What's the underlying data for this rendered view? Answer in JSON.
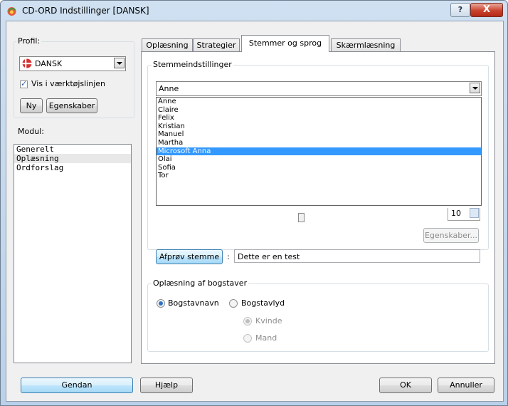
{
  "window": {
    "title": "CD-ORD Indstillinger [DANSK]",
    "help_label": "?",
    "close_label": "X"
  },
  "profile": {
    "group_label": "Profil:",
    "selected": "DANSK",
    "toolbar_checkbox_label": "Vis i værktøjslinjen",
    "toolbar_checked": true,
    "new_button": "Ny",
    "properties_button": "Egenskaber"
  },
  "module": {
    "group_label": "Modul:",
    "items": [
      "Generelt",
      "Oplæsning",
      "Ordforslag"
    ],
    "selected_index": 1
  },
  "tabs": [
    {
      "label": "Oplæsning"
    },
    {
      "label": "Strategier"
    },
    {
      "label": "Stemmer og sprog"
    },
    {
      "label": "Skærmlæsning"
    }
  ],
  "active_tab": 2,
  "voice_settings": {
    "group_label": "Stemmeindstillinger",
    "selected_voice": "Anne",
    "voice_options": [
      "Anne",
      "Claire",
      "Felix",
      "Kristian",
      "Manuel",
      "Martha",
      "Microsoft Anna",
      "Olai",
      "Sofia",
      "Tor"
    ],
    "highlighted_index": 6,
    "spin_value": "10",
    "properties_button": "Egenskaber...",
    "test_button": "Afprøv stemme",
    "test_separator": ":",
    "test_text": "Dette er en test"
  },
  "letters": {
    "group_label": "Oplæsning af bogstaver",
    "letter_name": "Bogstavnavn",
    "letter_sound": "Bogstavlyd",
    "female": "Kvinde",
    "male": "Mand"
  },
  "footer": {
    "restore_button": "Gendan",
    "help_button": "Hjælp",
    "ok_button": "OK",
    "cancel_button": "Annuller"
  }
}
